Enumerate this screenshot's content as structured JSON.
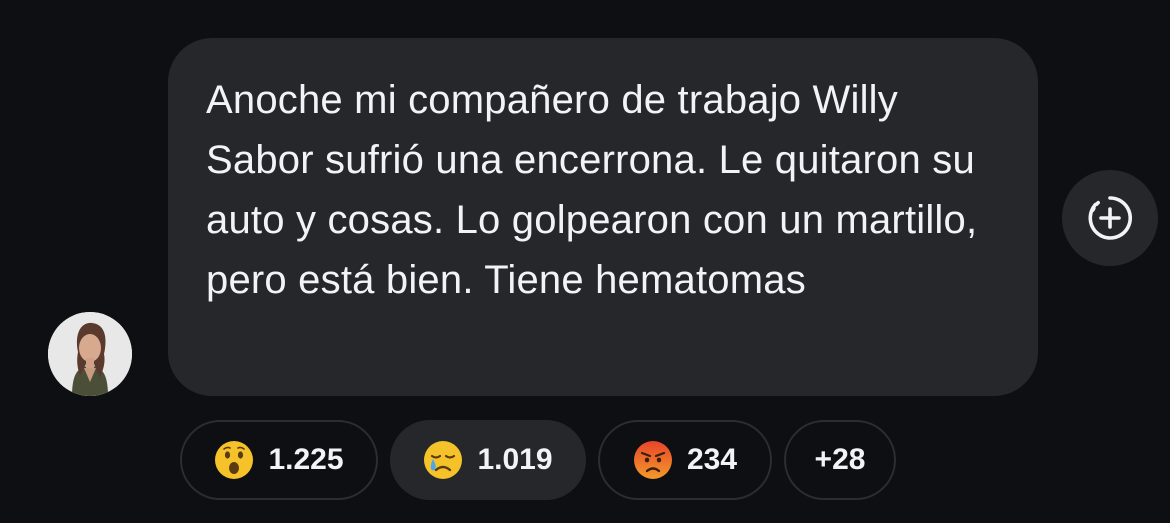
{
  "message": {
    "text": "Anoche mi compañero de trabajo Willy Sabor sufrió una encerrona. Le quitaron su auto y cosas. Lo golpearon con un martillo, pero está bien. Tiene hematomas"
  },
  "sender": {
    "avatar_icon": "user-avatar"
  },
  "add_reaction": {
    "icon": "add-reaction-icon"
  },
  "reactions": [
    {
      "icon": "surprised-face-emoji",
      "count": "1.225",
      "selected": false
    },
    {
      "icon": "crying-face-emoji",
      "count": "1.019",
      "selected": true
    },
    {
      "icon": "angry-face-emoji",
      "count": "234",
      "selected": false
    }
  ],
  "more_reactions": {
    "label": "+28"
  },
  "colors": {
    "background": "#0e0f13",
    "bubble": "#26272b",
    "text": "#f2f3f5",
    "chip_border": "#2c2d32"
  }
}
